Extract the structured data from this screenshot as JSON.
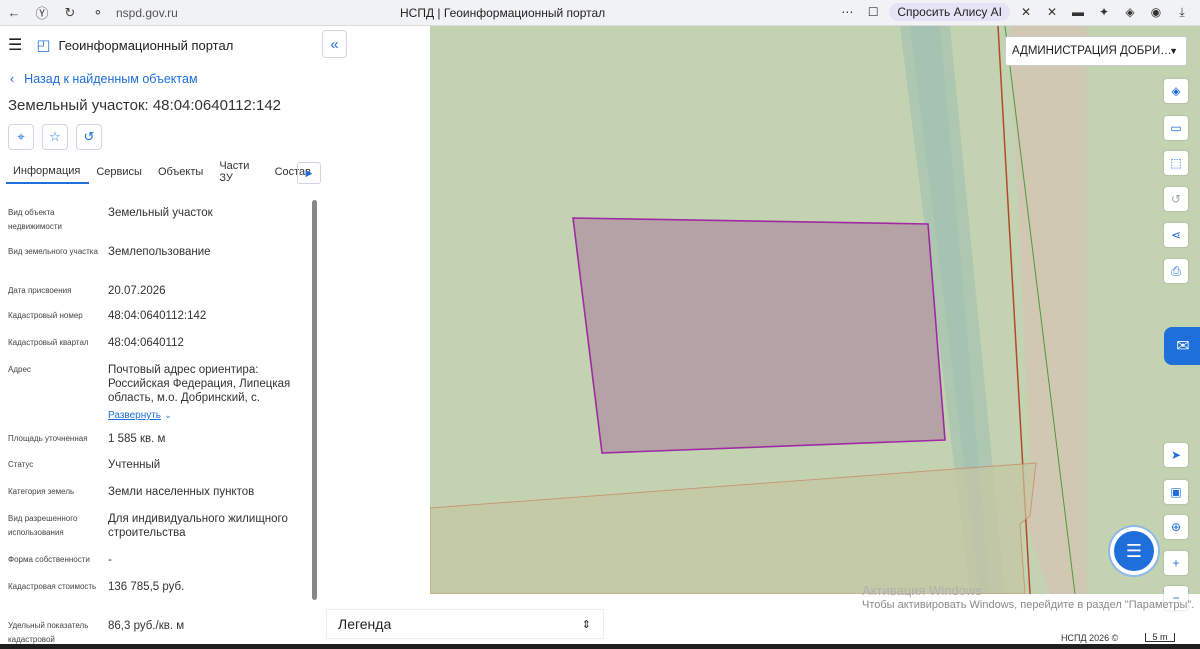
{
  "browser": {
    "url": "nspd.gov.ru",
    "tab_title": "НСПД | Геоинформационный портал",
    "alice_label": "Спросить Алису AI"
  },
  "app": {
    "title": "Геоинформационный портал",
    "back_link": "Назад к найденным объектам",
    "object_title": "Земельный участок: 48:04:0640112:142"
  },
  "tabs": [
    "Информация",
    "Сервисы",
    "Объекты",
    "Части ЗУ",
    "Состав"
  ],
  "properties": [
    {
      "label": "Вид объекта недвижимости",
      "value": "Земельный участок"
    },
    {
      "label": "Вид земельного участка",
      "value": "Землепользование"
    },
    {
      "label": "Дата присвоения",
      "value": "20.07.2026"
    },
    {
      "label": "Кадастровый номер",
      "value": "48:04:0640112:142"
    },
    {
      "label": "Кадастровый квартал",
      "value": "48:04:0640112"
    },
    {
      "label": "Адрес",
      "value": "Почтовый адрес ориентира: Российская Федерация, Липецкая область, м.о. Добринский, с."
    },
    {
      "label": "Площадь уточненная",
      "value": "1 585 кв. м"
    },
    {
      "label": "Статус",
      "value": "Учтенный"
    },
    {
      "label": "Категория земель",
      "value": "Земли населенных пунктов"
    },
    {
      "label": "Вид разрешенного использования",
      "value": "Для индивидуального жилищного строительства"
    },
    {
      "label": "Форма собственности",
      "value": "-"
    },
    {
      "label": "Кадастровая стоимость",
      "value": "136 785,5 руб."
    },
    {
      "label": "Удельный показатель кадастровой",
      "value": "86,3 руб./кв. м"
    }
  ],
  "expand_label": "Развернуть",
  "map": {
    "admin_select": "АДМИНИСТРАЦИЯ ДОБРИ…",
    "legend_label": "Легенда",
    "footer": "НСПД 2026 ©",
    "scale_label": "5 m",
    "windows_title": "Активация Windows",
    "windows_text": "Чтобы активировать Windows, перейдите в раздел \"Параметры\".",
    "colors": {
      "map_bg": "#c3d3b1",
      "parcel_fill": "#b4a2a4",
      "parcel_stroke": "#a02aa6",
      "accent": "#1e6fd9"
    }
  }
}
